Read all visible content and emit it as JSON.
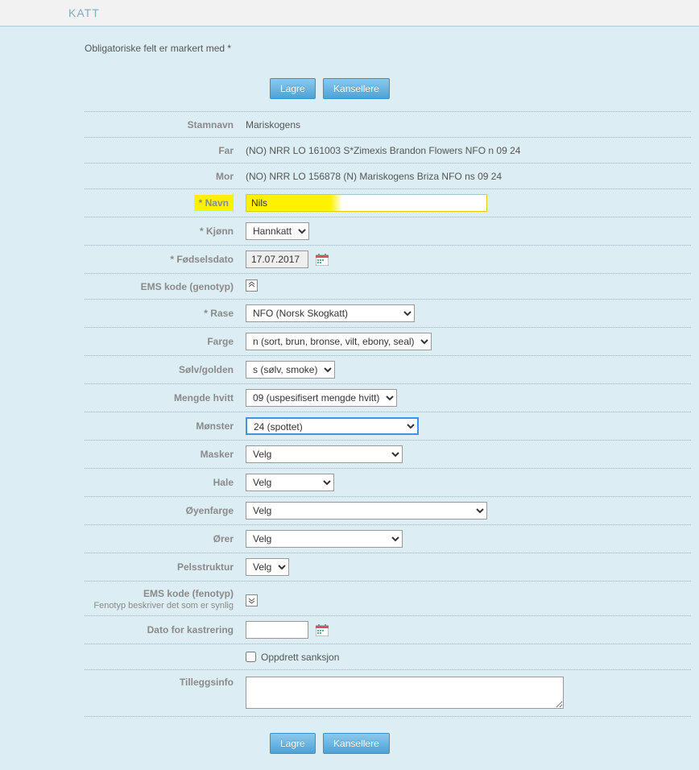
{
  "header": {
    "title": "KATT"
  },
  "intro": "Obligatoriske felt er markert med *",
  "buttons": {
    "save": "Lagre",
    "cancel": "Kansellere"
  },
  "fields": {
    "stamnavn": {
      "label": "Stamnavn",
      "value": "Mariskogens"
    },
    "far": {
      "label": "Far",
      "value": "(NO) NRR LO 161003 S*Zimexis Brandon Flowers NFO n 09 24"
    },
    "mor": {
      "label": "Mor",
      "value": "(NO) NRR LO 156878 (N) Mariskogens Briza NFO ns 09 24"
    },
    "navn": {
      "label": "* Navn",
      "value": "Nils"
    },
    "kjonn": {
      "label": "* Kjønn",
      "value": "Hannkatt"
    },
    "fodselsdato": {
      "label": "* Fødselsdato",
      "value": "17.07.2017"
    },
    "ems_genotyp": {
      "label": "EMS kode (genotyp)"
    },
    "rase": {
      "label": "* Rase",
      "value": "NFO (Norsk Skogkatt)"
    },
    "farge": {
      "label": "Farge",
      "value": "n (sort, brun, bronse, vilt, ebony, seal)"
    },
    "solv": {
      "label": "Sølv/golden",
      "value": "s (sølv, smoke)"
    },
    "mengde_hvitt": {
      "label": "Mengde hvitt",
      "value": "09 (uspesifisert mengde hvitt)"
    },
    "monster": {
      "label": "Mønster",
      "value": "24 (spottet)"
    },
    "masker": {
      "label": "Masker",
      "value": "Velg"
    },
    "hale": {
      "label": "Hale",
      "value": "Velg"
    },
    "oyenfarge": {
      "label": "Øyenfarge",
      "value": "Velg"
    },
    "orer": {
      "label": "Ører",
      "value": "Velg"
    },
    "pelsstruktur": {
      "label": "Pelsstruktur",
      "value": "Velg"
    },
    "ems_fenotyp": {
      "label": "EMS kode (fenotyp)",
      "subtext": "Fenotyp beskriver det som er synlig"
    },
    "kastrering": {
      "label": "Dato for kastrering",
      "value": ""
    },
    "oppdrett": {
      "label": "Oppdrett sanksjon"
    },
    "tillegg": {
      "label": "Tilleggsinfo",
      "value": ""
    }
  }
}
